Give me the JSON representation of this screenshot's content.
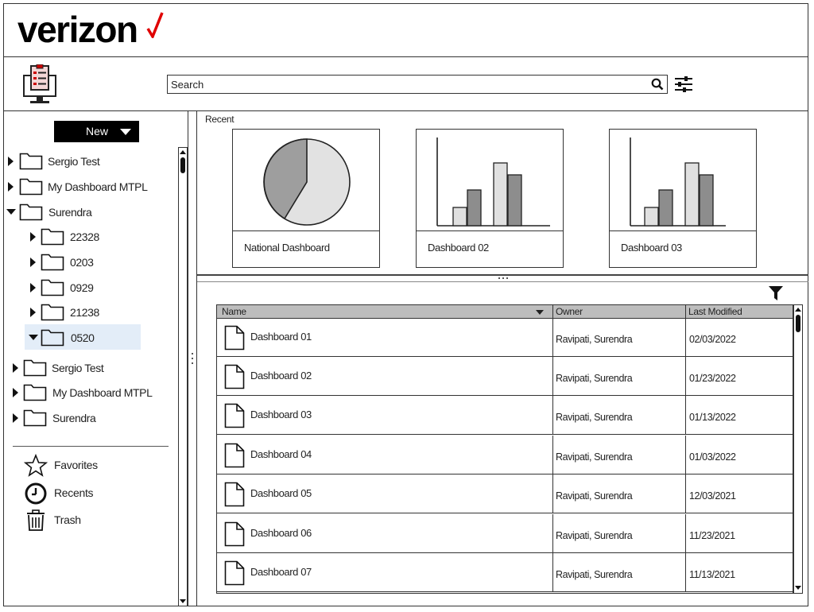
{
  "brand": {
    "logo_text": "verizon"
  },
  "search": {
    "placeholder": "Search"
  },
  "sidebar": {
    "new_button": "New",
    "tree": [
      {
        "label": "Sergio Test",
        "state": "collapsed"
      },
      {
        "label": "My Dashboard MTPL",
        "state": "collapsed"
      },
      {
        "label": "Surendra",
        "state": "expanded"
      },
      {
        "label": "22328",
        "state": "collapsed"
      },
      {
        "label": "0203",
        "state": "collapsed"
      },
      {
        "label": "0929",
        "state": "collapsed"
      },
      {
        "label": "21238",
        "state": "collapsed"
      },
      {
        "label": "0520",
        "state": "expanded",
        "selected": true
      },
      {
        "label": "Sergio Test",
        "state": "collapsed"
      },
      {
        "label": "My Dashboard MTPL",
        "state": "collapsed"
      },
      {
        "label": "Surendra",
        "state": "collapsed"
      }
    ],
    "nav": [
      {
        "label": "Favorites",
        "icon": "star-icon"
      },
      {
        "label": "Recents",
        "icon": "clock-icon"
      },
      {
        "label": "Trash",
        "icon": "trash-icon"
      }
    ]
  },
  "recent": {
    "label": "Recent",
    "cards": [
      {
        "title": "National Dashboard",
        "thumbnail": "pie-chart"
      },
      {
        "title": "Dashboard 02",
        "thumbnail": "bar-chart"
      },
      {
        "title": "Dashboard 03",
        "thumbnail": "bar-chart"
      }
    ]
  },
  "table": {
    "columns": {
      "name": "Name",
      "owner": "Owner",
      "modified": "Last Modified"
    },
    "rows": [
      {
        "name": "Dashboard 01",
        "owner": "Ravipati, Surendra",
        "modified": "02/03/2022"
      },
      {
        "name": "Dashboard 02",
        "owner": "Ravipati, Surendra",
        "modified": "01/23/2022"
      },
      {
        "name": "Dashboard 03",
        "owner": "Ravipati, Surendra",
        "modified": "01/13/2022"
      },
      {
        "name": "Dashboard 04",
        "owner": "Ravipati, Surendra",
        "modified": "01/03/2022"
      },
      {
        "name": "Dashboard 05",
        "owner": "Ravipati, Surendra",
        "modified": "12/03/2021"
      },
      {
        "name": "Dashboard 06",
        "owner": "Ravipati, Surendra",
        "modified": "11/23/2021"
      },
      {
        "name": "Dashboard 07",
        "owner": "Ravipati, Surendra",
        "modified": "11/13/2021"
      }
    ]
  },
  "colors": {
    "brand_check": "#e00000",
    "selected_row": "#e3edf8",
    "header_bg": "#bdbdbd"
  }
}
